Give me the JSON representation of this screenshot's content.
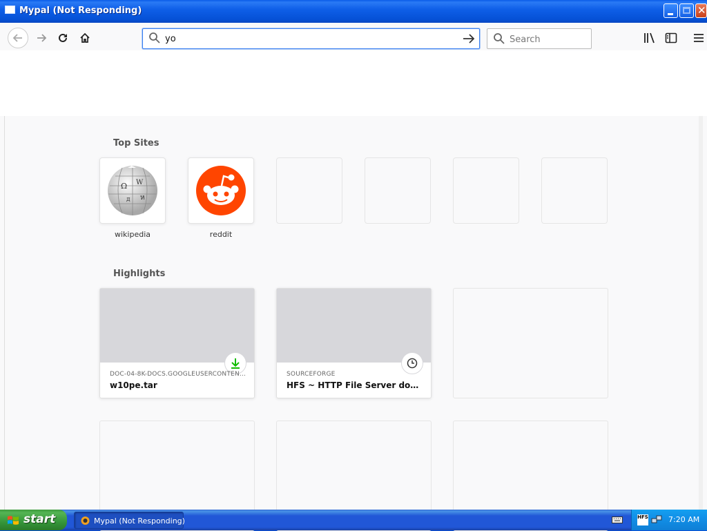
{
  "window": {
    "title": "Mypal (Not Responding)"
  },
  "toolbar": {
    "url_value": "yo",
    "search_placeholder": "Search"
  },
  "topsites": {
    "heading": "Top Sites",
    "items": [
      {
        "label": "wikipedia",
        "icon": "wikipedia-globe-icon"
      },
      {
        "label": "reddit",
        "icon": "reddit-alien-icon"
      },
      {
        "label": ""
      },
      {
        "label": ""
      },
      {
        "label": ""
      },
      {
        "label": ""
      }
    ]
  },
  "highlights": {
    "heading": "Highlights",
    "items": [
      {
        "source": "DOC-04-8K-DOCS.GOOGLEUSERCONTEN…",
        "title": "w10pe.tar",
        "badge": "download-icon"
      },
      {
        "source": "SOURCEFORGE",
        "title": "HFS ~ HTTP File Server downloa…",
        "badge": "clock-icon"
      }
    ]
  },
  "taskbar": {
    "start_label": "start",
    "task_label": "Mypal (Not Responding)",
    "tray_hfs": "HFS",
    "clock": "7:20 AM"
  },
  "colors": {
    "titlebar_blue": "#0551d6",
    "url_focus_border": "#3b80f0",
    "reddit_orange": "#ff4500",
    "download_green": "#12bc00",
    "start_green": "#36963a"
  }
}
